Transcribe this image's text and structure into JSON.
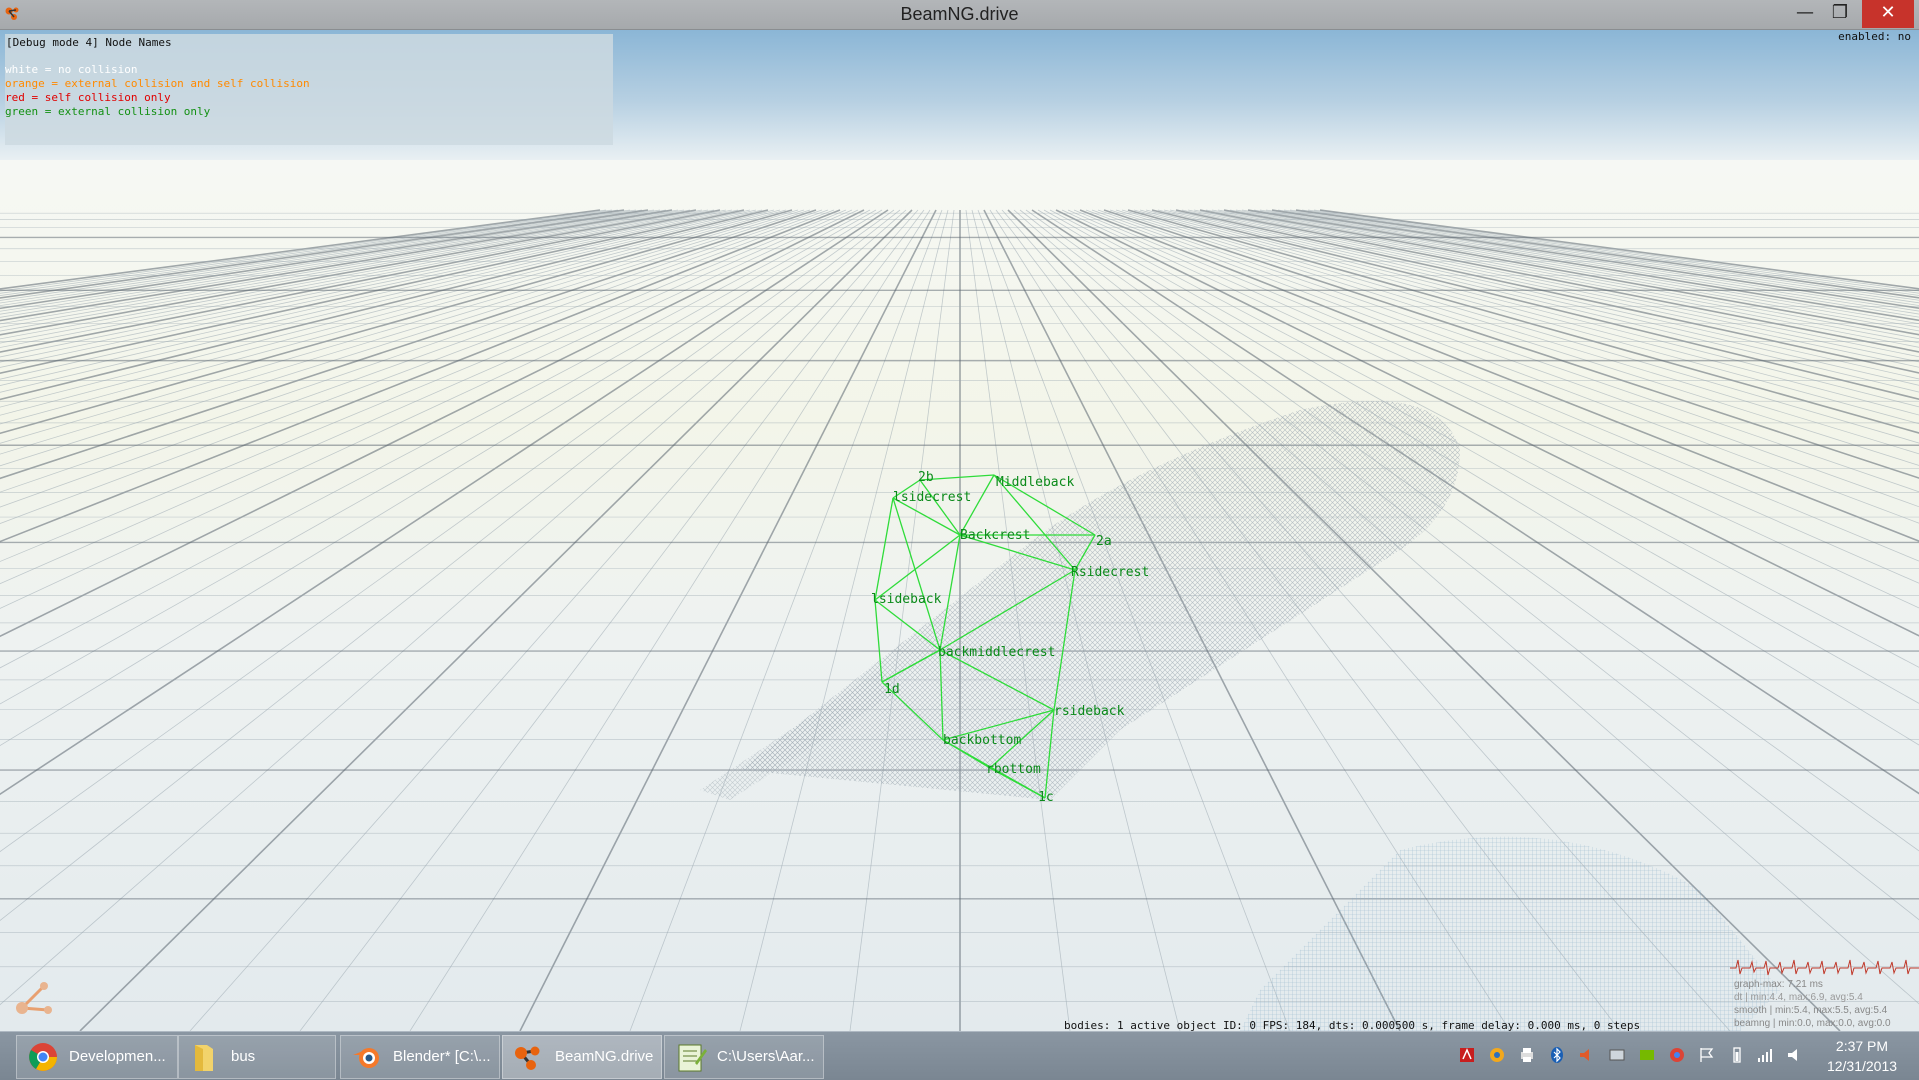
{
  "window": {
    "title": "BeamNG.drive"
  },
  "debug": {
    "title": "[Debug mode 4] Node Names",
    "legend": [
      {
        "text": "white = no collision",
        "color": "#ffffff"
      },
      {
        "text": "orange = external collision and self collision",
        "color": "#ff8a00"
      },
      {
        "text": "red = self collision only",
        "color": "#e00000"
      },
      {
        "text": "green = external collision only",
        "color": "#139013"
      }
    ],
    "enabled": "enabled: no"
  },
  "nodes": [
    "2b",
    "Middleback",
    "lsidecrest",
    "Backcrest",
    "2a",
    "Rsidecrest",
    "lsideback",
    "backmiddlecrest",
    "1d",
    "rsideback",
    "backbottom",
    "rbottom",
    "1c"
  ],
  "status": {
    "bar": "bodies: 1  active object ID: 0     FPS: 184, dts: 0.000500 s, frame delay: 0.000 ms, 0 steps"
  },
  "graph": {
    "lines": [
      "graph-max: 7.21 ms",
      "dt   | min:4.4, max:6.9, avg:5.4",
      "smooth | min:5.4, max:5.5, avg:5.4",
      "beamng | min:0.0, max:0.0, avg:0.0"
    ]
  },
  "taskbar": {
    "items": [
      {
        "label": "Developmen...",
        "icon": "chrome-icon"
      },
      {
        "label": "bus",
        "icon": "folder-icon"
      },
      {
        "label": "Blender* [C:\\...",
        "icon": "blender-icon"
      },
      {
        "label": "BeamNG.drive",
        "icon": "beamng-icon"
      },
      {
        "label": "C:\\Users\\Aar...",
        "icon": "notepad-icon"
      }
    ],
    "clock": {
      "time": "2:37 PM",
      "date": "12/31/2013"
    }
  },
  "colors": {
    "node_green": "#0b8a1a",
    "wire_green": "#2fdc3a",
    "close_red": "#c7332b"
  }
}
